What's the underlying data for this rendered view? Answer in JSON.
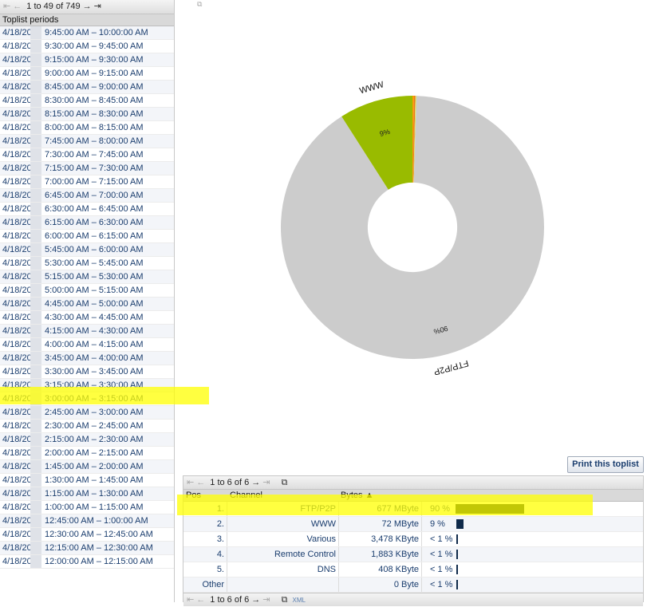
{
  "periods_pager": {
    "first_icon": "first-page-icon",
    "prev_icon": "prev-page-icon",
    "range_text": "1 to 49 of 749",
    "next_icon": "next-page-icon",
    "last_icon": "last-page-icon"
  },
  "periods_header": "Toplist periods",
  "periods": [
    {
      "date": "4/18/20",
      "time": "9:45:00 AM – 10:00:00 AM"
    },
    {
      "date": "4/18/20",
      "time": "9:30:00 AM – 9:45:00 AM"
    },
    {
      "date": "4/18/20",
      "time": "9:15:00 AM – 9:30:00 AM"
    },
    {
      "date": "4/18/20",
      "time": "9:00:00 AM – 9:15:00 AM"
    },
    {
      "date": "4/18/20",
      "time": "8:45:00 AM – 9:00:00 AM"
    },
    {
      "date": "4/18/20",
      "time": "8:30:00 AM – 8:45:00 AM"
    },
    {
      "date": "4/18/20",
      "time": "8:15:00 AM – 8:30:00 AM"
    },
    {
      "date": "4/18/20",
      "time": "8:00:00 AM – 8:15:00 AM"
    },
    {
      "date": "4/18/20",
      "time": "7:45:00 AM – 8:00:00 AM"
    },
    {
      "date": "4/18/20",
      "time": "7:30:00 AM – 7:45:00 AM"
    },
    {
      "date": "4/18/20",
      "time": "7:15:00 AM – 7:30:00 AM"
    },
    {
      "date": "4/18/20",
      "time": "7:00:00 AM – 7:15:00 AM"
    },
    {
      "date": "4/18/20",
      "time": "6:45:00 AM – 7:00:00 AM"
    },
    {
      "date": "4/18/20",
      "time": "6:30:00 AM – 6:45:00 AM"
    },
    {
      "date": "4/18/20",
      "time": "6:15:00 AM – 6:30:00 AM"
    },
    {
      "date": "4/18/20",
      "time": "6:00:00 AM – 6:15:00 AM"
    },
    {
      "date": "4/18/20",
      "time": "5:45:00 AM – 6:00:00 AM"
    },
    {
      "date": "4/18/20",
      "time": "5:30:00 AM – 5:45:00 AM"
    },
    {
      "date": "4/18/20",
      "time": "5:15:00 AM – 5:30:00 AM"
    },
    {
      "date": "4/18/20",
      "time": "5:00:00 AM – 5:15:00 AM"
    },
    {
      "date": "4/18/20",
      "time": "4:45:00 AM – 5:00:00 AM"
    },
    {
      "date": "4/18/20",
      "time": "4:30:00 AM – 4:45:00 AM"
    },
    {
      "date": "4/18/20",
      "time": "4:15:00 AM – 4:30:00 AM"
    },
    {
      "date": "4/18/20",
      "time": "4:00:00 AM – 4:15:00 AM"
    },
    {
      "date": "4/18/20",
      "time": "3:45:00 AM – 4:00:00 AM"
    },
    {
      "date": "4/18/20",
      "time": "3:30:00 AM – 3:45:00 AM"
    },
    {
      "date": "4/18/20",
      "time": "3:15:00 AM – 3:30:00 AM"
    },
    {
      "date": "4/18/20",
      "time": "3:00:00 AM – 3:15:00 AM"
    },
    {
      "date": "4/18/20",
      "time": "2:45:00 AM – 3:00:00 AM"
    },
    {
      "date": "4/18/20",
      "time": "2:30:00 AM – 2:45:00 AM"
    },
    {
      "date": "4/18/20",
      "time": "2:15:00 AM – 2:30:00 AM"
    },
    {
      "date": "4/18/20",
      "time": "2:00:00 AM – 2:15:00 AM"
    },
    {
      "date": "4/18/20",
      "time": "1:45:00 AM – 2:00:00 AM"
    },
    {
      "date": "4/18/20",
      "time": "1:30:00 AM – 1:45:00 AM"
    },
    {
      "date": "4/18/20",
      "time": "1:15:00 AM – 1:30:00 AM"
    },
    {
      "date": "4/18/20",
      "time": "1:00:00 AM – 1:15:00 AM"
    },
    {
      "date": "4/18/20",
      "time": "12:45:00 AM – 1:00:00 AM"
    },
    {
      "date": "4/18/20",
      "time": "12:30:00 AM – 12:45:00 AM"
    },
    {
      "date": "4/18/20",
      "time": "12:15:00 AM – 12:30:00 AM"
    },
    {
      "date": "4/18/20",
      "time": "12:00:00 AM – 12:15:00 AM"
    }
  ],
  "chart_data": {
    "type": "pie",
    "categories": [
      "FTP/P2P",
      "WWW",
      "Various",
      "Remote Control",
      "DNS",
      "Other"
    ],
    "values": [
      90,
      9,
      0.5,
      0.3,
      0.2,
      0
    ],
    "slice_labels": [
      "90%",
      "9%"
    ],
    "colors": [
      "#cccccc",
      "#99bb00",
      "#ff9900",
      "#e87722",
      "#dddd55",
      "#bbbbbb"
    ],
    "inner_radius_fraction": 0.34
  },
  "print_button": "Print this toplist",
  "toplist_pager": {
    "range_text": "1 to 6 of 6"
  },
  "toplist_footer": {
    "range_text": "1 to 6 of 6",
    "xml_label": "XML"
  },
  "toplist_headers": {
    "pos": "Pos",
    "channel": "Channel",
    "bytes": "Bytes ▲"
  },
  "toplist": [
    {
      "pos": "1.",
      "channel": "FTP/P2P",
      "bytes": "677 MByte",
      "pct": "90 %",
      "share": 0.9
    },
    {
      "pos": "2.",
      "channel": "WWW",
      "bytes": "72 MByte",
      "pct": "9 %",
      "share": 0.09
    },
    {
      "pos": "3.",
      "channel": "Various",
      "bytes": "3,478 KByte",
      "pct": "< 1 %",
      "share": 0.005
    },
    {
      "pos": "4.",
      "channel": "Remote Control",
      "bytes": "1,883 KByte",
      "pct": "< 1 %",
      "share": 0.003
    },
    {
      "pos": "5.",
      "channel": "DNS",
      "bytes": "408 KByte",
      "pct": "< 1 %",
      "share": 0.001
    },
    {
      "pos": "Other",
      "channel": "",
      "bytes": "0 Byte",
      "pct": "< 1 %",
      "share": 0.0
    }
  ]
}
